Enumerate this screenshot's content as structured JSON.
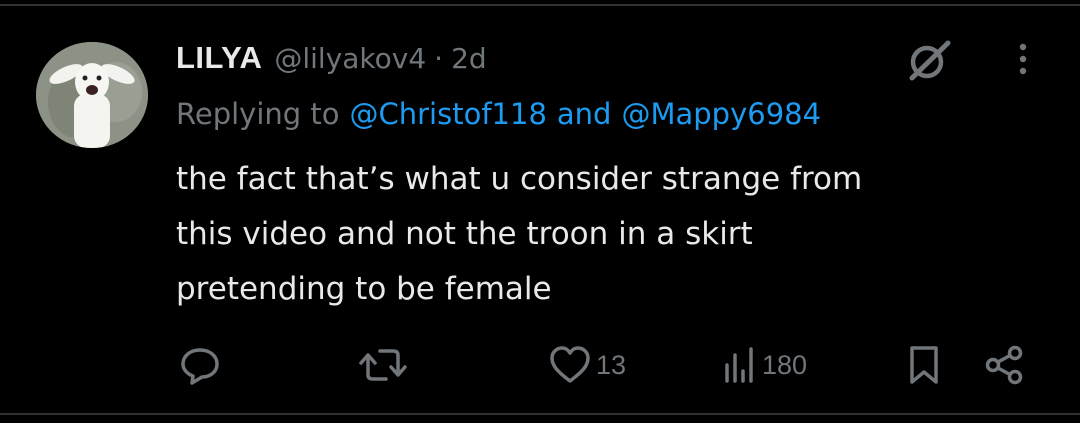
{
  "tweet": {
    "author": {
      "display_name": "LILYA",
      "handle": "@lilyakov4",
      "separator": "·",
      "time": "2d",
      "avatar_icon": "white-goat-avatar"
    },
    "reply": {
      "prefix": "Replying to",
      "mention_1": "@Christof118",
      "conjunction": "and",
      "mention_2": "@Mappy6984"
    },
    "text_lines": [
      "the fact that’s what u consider strange from",
      "this video and not the troon in a skirt",
      "pretending to be female"
    ],
    "actions": {
      "reply_count": "",
      "retweet_count": "",
      "like_count": "13",
      "views_count": "180"
    },
    "icons": {
      "grok": "grok-icon",
      "more": "more-vertical-icon",
      "reply": "reply-icon",
      "retweet": "retweet-icon",
      "like": "heart-icon",
      "views": "views-chart-icon",
      "bookmark": "bookmark-icon",
      "share": "share-icon"
    }
  },
  "colors": {
    "background": "#000000",
    "text": "#e7e9ea",
    "muted": "#71767b",
    "link": "#1d9bf0",
    "divider": "#2f3336"
  }
}
